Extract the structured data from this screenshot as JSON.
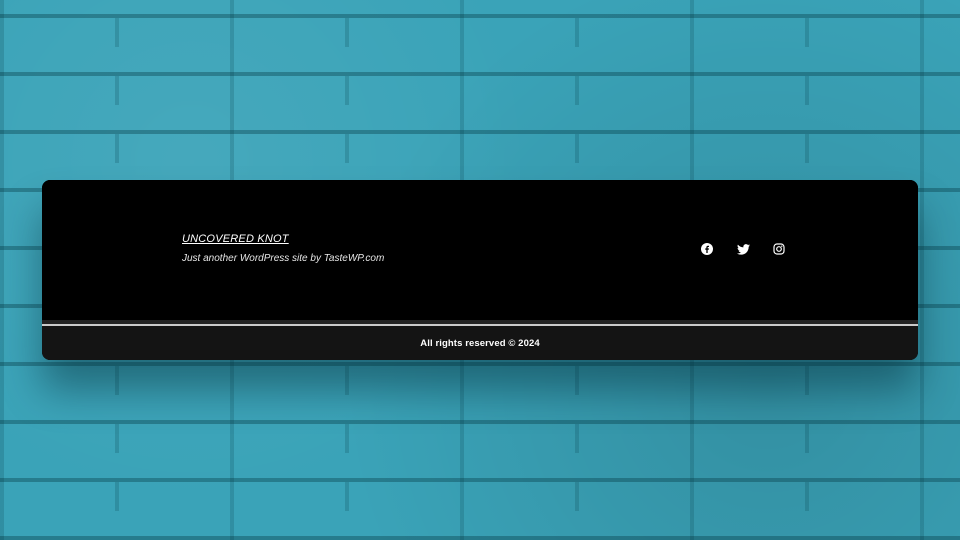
{
  "site": {
    "title": "UNCOVERED KNOT",
    "tagline": "Just another WordPress site by TasteWP.com"
  },
  "social": [
    {
      "icon": "facebook-icon"
    },
    {
      "icon": "twitter-icon"
    },
    {
      "icon": "instagram-icon"
    }
  ],
  "footer": {
    "copyright": "All rights reserved © 2024"
  },
  "colors": {
    "wall": "#3aa3b8",
    "card": "#000000",
    "bottom_bar": "#141414",
    "text": "#ffffff"
  }
}
